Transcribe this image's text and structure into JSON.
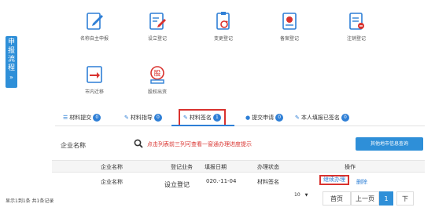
{
  "side_tab": {
    "chars": [
      "申",
      "报",
      "流",
      "程"
    ],
    "caret": "»"
  },
  "services": [
    {
      "label": "名称自主申报",
      "icon": "pen-document-icon"
    },
    {
      "label": "设立登记",
      "icon": "edit-document-icon"
    },
    {
      "label": "变更登记",
      "icon": "refresh-document-icon"
    },
    {
      "label": "备案登记",
      "icon": "certificate-icon"
    },
    {
      "label": "注销登记",
      "icon": "cancel-document-icon"
    },
    {
      "label": "市内迁移",
      "icon": "transfer-icon"
    },
    {
      "label": "股权出资",
      "icon": "stock-seal-icon"
    }
  ],
  "tabs": [
    {
      "label": "材料提交",
      "count": "0"
    },
    {
      "label": "材料指导",
      "count": "0"
    },
    {
      "label": "材料签名",
      "count": "1"
    },
    {
      "label": "提交申请",
      "count": "0"
    },
    {
      "label": "本人填报已签名",
      "count": "0"
    }
  ],
  "search": {
    "label": "企业名称",
    "hint": "点击列表前三列可查看一窗通办理进度提示",
    "button": "其他地市信息查询"
  },
  "table": {
    "headers": [
      "企业名称",
      "登记业务",
      "填报日期",
      "办理状态",
      "操作"
    ],
    "rows": [
      {
        "name": "企业名称",
        "business": "设立登记",
        "date": "020.-11-04",
        "status": "材料签名",
        "action": "继续办理",
        "delete": "删除"
      }
    ]
  },
  "footer": {
    "summary": "显示1到1条 共1条记录",
    "page_size": "10",
    "first": "首页",
    "prev": "上一页",
    "current": "1",
    "next": "下"
  },
  "colors": {
    "accent": "#2e8fd8",
    "highlight": "#d9322e"
  }
}
